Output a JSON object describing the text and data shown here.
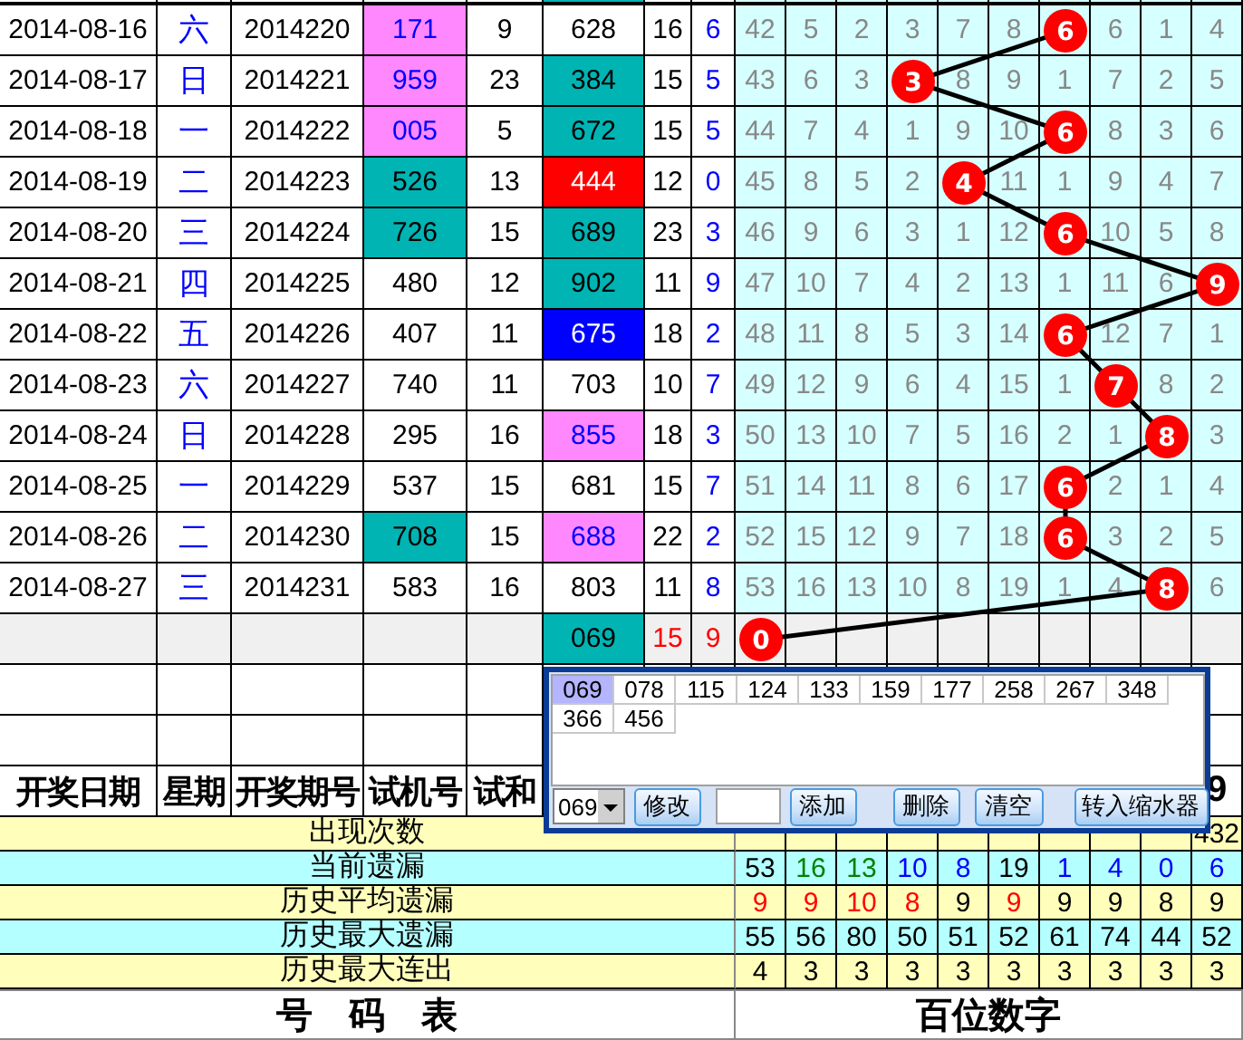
{
  "rows": [
    {
      "date": "2014-08-16",
      "weekday": "六",
      "period": "2014220",
      "trial": {
        "text": "171",
        "color": "#ff88ff"
      },
      "trial_sum": "9",
      "number": {
        "text": "628"
      },
      "sum": "16",
      "span": "6",
      "cells": [
        {
          "text": "42",
          "hit": false
        },
        {
          "text": "5",
          "hit": false
        },
        {
          "text": "2",
          "hit": false
        },
        {
          "text": "3",
          "hit": false
        },
        {
          "text": "7",
          "hit": false
        },
        {
          "text": "8",
          "hit": false
        },
        {
          "text": "6",
          "hit": true
        },
        {
          "text": "6",
          "hit": false
        },
        {
          "text": "1",
          "hit": false
        },
        {
          "text": "4",
          "hit": false
        }
      ]
    },
    {
      "date": "2014-08-17",
      "weekday": "日",
      "period": "2014221",
      "trial": {
        "text": "959",
        "color": "#ff88ff"
      },
      "trial_sum": "23",
      "number": {
        "text": "384",
        "color": "#00b4b4"
      },
      "sum": "15",
      "span": "5",
      "cells": [
        {
          "text": "43",
          "hit": false
        },
        {
          "text": "6",
          "hit": false
        },
        {
          "text": "3",
          "hit": false
        },
        {
          "text": "3",
          "hit": true
        },
        {
          "text": "8",
          "hit": false
        },
        {
          "text": "9",
          "hit": false
        },
        {
          "text": "1",
          "hit": false
        },
        {
          "text": "7",
          "hit": false
        },
        {
          "text": "2",
          "hit": false
        },
        {
          "text": "5",
          "hit": false
        }
      ]
    },
    {
      "date": "2014-08-18",
      "weekday": "一",
      "period": "2014222",
      "trial": {
        "text": "005",
        "color": "#ff88ff"
      },
      "trial_sum": "5",
      "number": {
        "text": "672",
        "color": "#00b4b4"
      },
      "sum": "15",
      "span": "5",
      "cells": [
        {
          "text": "44",
          "hit": false
        },
        {
          "text": "7",
          "hit": false
        },
        {
          "text": "4",
          "hit": false
        },
        {
          "text": "1",
          "hit": false
        },
        {
          "text": "9",
          "hit": false
        },
        {
          "text": "10",
          "hit": false
        },
        {
          "text": "6",
          "hit": true
        },
        {
          "text": "8",
          "hit": false
        },
        {
          "text": "3",
          "hit": false
        },
        {
          "text": "6",
          "hit": false
        }
      ]
    },
    {
      "date": "2014-08-19",
      "weekday": "二",
      "period": "2014223",
      "trial": {
        "text": "526",
        "color": "#00b4b4"
      },
      "trial_sum": "13",
      "number": {
        "text": "444",
        "color": "#ff0000"
      },
      "sum": "12",
      "span": "0",
      "cells": [
        {
          "text": "45",
          "hit": false
        },
        {
          "text": "8",
          "hit": false
        },
        {
          "text": "5",
          "hit": false
        },
        {
          "text": "2",
          "hit": false
        },
        {
          "text": "4",
          "hit": true
        },
        {
          "text": "11",
          "hit": false
        },
        {
          "text": "1",
          "hit": false
        },
        {
          "text": "9",
          "hit": false
        },
        {
          "text": "4",
          "hit": false
        },
        {
          "text": "7",
          "hit": false
        }
      ]
    },
    {
      "date": "2014-08-20",
      "weekday": "三",
      "period": "2014224",
      "trial": {
        "text": "726",
        "color": "#00b4b4"
      },
      "trial_sum": "15",
      "number": {
        "text": "689",
        "color": "#00b4b4"
      },
      "sum": "23",
      "span": "3",
      "cells": [
        {
          "text": "46",
          "hit": false
        },
        {
          "text": "9",
          "hit": false
        },
        {
          "text": "6",
          "hit": false
        },
        {
          "text": "3",
          "hit": false
        },
        {
          "text": "1",
          "hit": false
        },
        {
          "text": "12",
          "hit": false
        },
        {
          "text": "6",
          "hit": true
        },
        {
          "text": "10",
          "hit": false
        },
        {
          "text": "5",
          "hit": false
        },
        {
          "text": "8",
          "hit": false
        }
      ]
    },
    {
      "date": "2014-08-21",
      "weekday": "四",
      "period": "2014225",
      "trial": {
        "text": "480"
      },
      "trial_sum": "12",
      "number": {
        "text": "902",
        "color": "#00b4b4"
      },
      "sum": "11",
      "span": "9",
      "cells": [
        {
          "text": "47",
          "hit": false
        },
        {
          "text": "10",
          "hit": false
        },
        {
          "text": "7",
          "hit": false
        },
        {
          "text": "4",
          "hit": false
        },
        {
          "text": "2",
          "hit": false
        },
        {
          "text": "13",
          "hit": false
        },
        {
          "text": "1",
          "hit": false
        },
        {
          "text": "11",
          "hit": false
        },
        {
          "text": "6",
          "hit": false
        },
        {
          "text": "9",
          "hit": true
        }
      ]
    },
    {
      "date": "2014-08-22",
      "weekday": "五",
      "period": "2014226",
      "trial": {
        "text": "407"
      },
      "trial_sum": "11",
      "number": {
        "text": "675",
        "color": "#0000ff"
      },
      "sum": "18",
      "span": "2",
      "cells": [
        {
          "text": "48",
          "hit": false
        },
        {
          "text": "11",
          "hit": false
        },
        {
          "text": "8",
          "hit": false
        },
        {
          "text": "5",
          "hit": false
        },
        {
          "text": "3",
          "hit": false
        },
        {
          "text": "14",
          "hit": false
        },
        {
          "text": "6",
          "hit": true
        },
        {
          "text": "12",
          "hit": false
        },
        {
          "text": "7",
          "hit": false
        },
        {
          "text": "1",
          "hit": false
        }
      ]
    },
    {
      "date": "2014-08-23",
      "weekday": "六",
      "period": "2014227",
      "trial": {
        "text": "740"
      },
      "trial_sum": "11",
      "number": {
        "text": "703"
      },
      "sum": "10",
      "span": "7",
      "cells": [
        {
          "text": "49",
          "hit": false
        },
        {
          "text": "12",
          "hit": false
        },
        {
          "text": "9",
          "hit": false
        },
        {
          "text": "6",
          "hit": false
        },
        {
          "text": "4",
          "hit": false
        },
        {
          "text": "15",
          "hit": false
        },
        {
          "text": "1",
          "hit": false
        },
        {
          "text": "7",
          "hit": true
        },
        {
          "text": "8",
          "hit": false
        },
        {
          "text": "2",
          "hit": false
        }
      ]
    },
    {
      "date": "2014-08-24",
      "weekday": "日",
      "period": "2014228",
      "trial": {
        "text": "295"
      },
      "trial_sum": "16",
      "number": {
        "text": "855",
        "color": "#ff88ff"
      },
      "sum": "18",
      "span": "3",
      "cells": [
        {
          "text": "50",
          "hit": false
        },
        {
          "text": "13",
          "hit": false
        },
        {
          "text": "10",
          "hit": false
        },
        {
          "text": "7",
          "hit": false
        },
        {
          "text": "5",
          "hit": false
        },
        {
          "text": "16",
          "hit": false
        },
        {
          "text": "2",
          "hit": false
        },
        {
          "text": "1",
          "hit": false
        },
        {
          "text": "8",
          "hit": true
        },
        {
          "text": "3",
          "hit": false
        }
      ]
    },
    {
      "date": "2014-08-25",
      "weekday": "一",
      "period": "2014229",
      "trial": {
        "text": "537"
      },
      "trial_sum": "15",
      "number": {
        "text": "681"
      },
      "sum": "15",
      "span": "7",
      "cells": [
        {
          "text": "51",
          "hit": false
        },
        {
          "text": "14",
          "hit": false
        },
        {
          "text": "11",
          "hit": false
        },
        {
          "text": "8",
          "hit": false
        },
        {
          "text": "6",
          "hit": false
        },
        {
          "text": "17",
          "hit": false
        },
        {
          "text": "6",
          "hit": true
        },
        {
          "text": "2",
          "hit": false
        },
        {
          "text": "1",
          "hit": false
        },
        {
          "text": "4",
          "hit": false
        }
      ]
    },
    {
      "date": "2014-08-26",
      "weekday": "二",
      "period": "2014230",
      "trial": {
        "text": "708",
        "color": "#00b4b4"
      },
      "trial_sum": "15",
      "number": {
        "text": "688",
        "color": "#ff88ff"
      },
      "sum": "22",
      "span": "2",
      "cells": [
        {
          "text": "52",
          "hit": false
        },
        {
          "text": "15",
          "hit": false
        },
        {
          "text": "12",
          "hit": false
        },
        {
          "text": "9",
          "hit": false
        },
        {
          "text": "7",
          "hit": false
        },
        {
          "text": "18",
          "hit": false
        },
        {
          "text": "6",
          "hit": true
        },
        {
          "text": "3",
          "hit": false
        },
        {
          "text": "2",
          "hit": false
        },
        {
          "text": "5",
          "hit": false
        }
      ]
    },
    {
      "date": "2014-08-27",
      "weekday": "三",
      "period": "2014231",
      "trial": {
        "text": "583"
      },
      "trial_sum": "16",
      "number": {
        "text": "803"
      },
      "sum": "11",
      "span": "8",
      "cells": [
        {
          "text": "53",
          "hit": false
        },
        {
          "text": "16",
          "hit": false
        },
        {
          "text": "13",
          "hit": false
        },
        {
          "text": "10",
          "hit": false
        },
        {
          "text": "8",
          "hit": false
        },
        {
          "text": "19",
          "hit": false
        },
        {
          "text": "1",
          "hit": false
        },
        {
          "text": "4",
          "hit": false
        },
        {
          "text": "8",
          "hit": true
        },
        {
          "text": "6",
          "hit": false
        }
      ]
    }
  ],
  "forecast": {
    "number": {
      "text": "069",
      "color": "#00b4b4"
    },
    "sum": "15",
    "span": "9",
    "cells": [
      {
        "text": "0",
        "hit": true
      }
    ]
  },
  "header": [
    "开奖日期",
    "星期",
    "开奖期号",
    "试机号",
    "试和"
  ],
  "header_digits": [
    "9"
  ],
  "stats": [
    {
      "label": "出现次数",
      "values": [
        {
          "text": "432"
        }
      ]
    },
    {
      "label": "当前遗漏",
      "values": [
        {
          "text": "53",
          "color": "#000000"
        },
        {
          "text": "16",
          "color": "#008000"
        },
        {
          "text": "13",
          "color": "#008000"
        },
        {
          "text": "10",
          "color": "#0000ff"
        },
        {
          "text": "8",
          "color": "#0000ff"
        },
        {
          "text": "19",
          "color": "#000000"
        },
        {
          "text": "1",
          "color": "#0000ff"
        },
        {
          "text": "4",
          "color": "#0000ff"
        },
        {
          "text": "0",
          "color": "#0000ff"
        },
        {
          "text": "6",
          "color": "#0000ff"
        }
      ]
    },
    {
      "label": "历史平均遗漏",
      "values": [
        {
          "text": "9",
          "color": "#ff0000"
        },
        {
          "text": "9",
          "color": "#ff0000"
        },
        {
          "text": "10",
          "color": "#ff0000"
        },
        {
          "text": "8",
          "color": "#ff0000"
        },
        {
          "text": "9",
          "color": "#000000"
        },
        {
          "text": "9",
          "color": "#ff0000"
        },
        {
          "text": "9",
          "color": "#000000"
        },
        {
          "text": "9",
          "color": "#000000"
        },
        {
          "text": "8",
          "color": "#000000"
        },
        {
          "text": "9",
          "color": "#000000"
        }
      ]
    },
    {
      "label": "历史最大遗漏",
      "values": [
        {
          "text": "55"
        },
        {
          "text": "56"
        },
        {
          "text": "80"
        },
        {
          "text": "50"
        },
        {
          "text": "51"
        },
        {
          "text": "52"
        },
        {
          "text": "61"
        },
        {
          "text": "74"
        },
        {
          "text": "44"
        },
        {
          "text": "52"
        }
      ]
    },
    {
      "label": "历史最大连出",
      "values": [
        {
          "text": "4"
        },
        {
          "text": "3"
        },
        {
          "text": "3"
        },
        {
          "text": "3"
        },
        {
          "text": "3"
        },
        {
          "text": "3"
        },
        {
          "text": "3"
        },
        {
          "text": "3"
        },
        {
          "text": "3"
        },
        {
          "text": "3"
        }
      ]
    }
  ],
  "footer": {
    "left": "号　码　表",
    "right": "百位数字"
  },
  "dialog": {
    "items": [
      {
        "text": "069",
        "selected": true
      },
      {
        "text": "078",
        "selected": false
      },
      {
        "text": "115",
        "selected": false
      },
      {
        "text": "124",
        "selected": false
      },
      {
        "text": "133",
        "selected": false
      },
      {
        "text": "159",
        "selected": false
      },
      {
        "text": "177",
        "selected": false
      },
      {
        "text": "258",
        "selected": false
      },
      {
        "text": "267",
        "selected": false
      },
      {
        "text": "348",
        "selected": false
      },
      {
        "text": "366",
        "selected": false
      },
      {
        "text": "456",
        "selected": false
      }
    ],
    "select": "069",
    "buttons": [
      {
        "label": "修改",
        "kind": "edit"
      },
      {
        "label": "添加",
        "kind": "add"
      },
      {
        "label": "删除",
        "kind": "delete"
      },
      {
        "label": "清空",
        "kind": "clear"
      },
      {
        "label": "转入缩水器",
        "kind": "export"
      }
    ]
  }
}
